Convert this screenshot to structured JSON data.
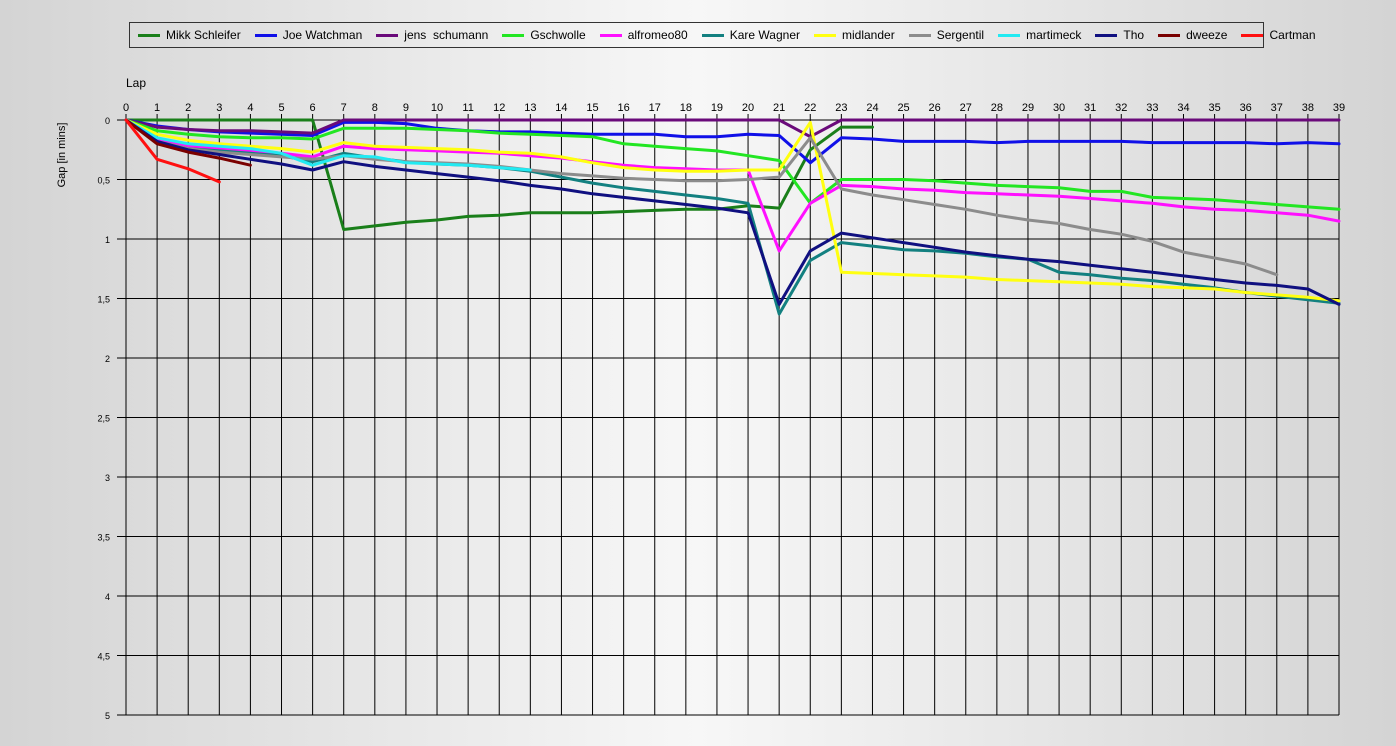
{
  "chart_data": {
    "type": "line",
    "title": "",
    "xlabel": "Lap",
    "ylabel": "Gap [in mins]",
    "xlim": [
      0,
      39
    ],
    "ylim": [
      0,
      5
    ],
    "y_inverted": true,
    "grid": true,
    "legend_position": "top",
    "x_ticks": [
      "0",
      "1",
      "2",
      "3",
      "4",
      "5",
      "6",
      "7",
      "8",
      "9",
      "10",
      "11",
      "12",
      "13",
      "14",
      "15",
      "16",
      "17",
      "18",
      "19",
      "20",
      "21",
      "22",
      "23",
      "24",
      "25",
      "26",
      "27",
      "28",
      "29",
      "30",
      "31",
      "32",
      "33",
      "34",
      "35",
      "36",
      "37",
      "38",
      "39"
    ],
    "y_ticks": [
      {
        "value": 0,
        "label": "0"
      },
      {
        "value": 0.5,
        "label": "0,5"
      },
      {
        "value": 1,
        "label": "1"
      },
      {
        "value": 1.5,
        "label": "1,5"
      },
      {
        "value": 2,
        "label": "2"
      },
      {
        "value": 2.5,
        "label": "2,5"
      },
      {
        "value": 3,
        "label": "3"
      },
      {
        "value": 3.5,
        "label": "3,5"
      },
      {
        "value": 4,
        "label": "4"
      },
      {
        "value": 4.5,
        "label": "4,5"
      },
      {
        "value": 5,
        "label": "5"
      }
    ],
    "series": [
      {
        "name": "Mikk Schleifer",
        "color": "#1a7f1a",
        "x": [
          0,
          1,
          2,
          3,
          4,
          5,
          6,
          7,
          8,
          9,
          10,
          11,
          12,
          13,
          14,
          15,
          16,
          17,
          18,
          19,
          20,
          21,
          22,
          23,
          24
        ],
        "y": [
          0,
          0,
          0,
          0,
          0,
          0,
          0,
          0.92,
          0.89,
          0.86,
          0.84,
          0.81,
          0.8,
          0.78,
          0.78,
          0.78,
          0.77,
          0.76,
          0.75,
          0.75,
          0.72,
          0.74,
          0.25,
          0.06,
          0.06
        ]
      },
      {
        "name": "Joe Watchman",
        "color": "#1010e8",
        "x": [
          0,
          1,
          2,
          3,
          4,
          5,
          6,
          7,
          8,
          9,
          10,
          11,
          12,
          13,
          14,
          15,
          16,
          17,
          18,
          19,
          20,
          21,
          22,
          23,
          24,
          25,
          26,
          27,
          28,
          29,
          30,
          31,
          32,
          33,
          34,
          35,
          36,
          37,
          38,
          39
        ],
        "y": [
          0,
          0.05,
          0.08,
          0.1,
          0.11,
          0.12,
          0.13,
          0.02,
          0.02,
          0.03,
          0.07,
          0.09,
          0.1,
          0.1,
          0.11,
          0.12,
          0.12,
          0.12,
          0.14,
          0.14,
          0.12,
          0.13,
          0.36,
          0.15,
          0.16,
          0.18,
          0.18,
          0.18,
          0.19,
          0.18,
          0.18,
          0.18,
          0.18,
          0.19,
          0.19,
          0.19,
          0.19,
          0.2,
          0.19,
          0.2
        ]
      },
      {
        "name": "jens  schumann",
        "color": "#6a0a7a",
        "x": [
          0,
          1,
          2,
          3,
          4,
          5,
          6,
          7,
          8,
          9,
          10,
          11,
          12,
          13,
          14,
          15,
          16,
          17,
          18,
          19,
          20,
          21,
          22,
          23,
          24,
          25,
          26,
          27,
          28,
          29,
          30,
          31,
          32,
          33,
          34,
          35,
          36,
          37,
          38,
          39
        ],
        "y": [
          0,
          0.06,
          0.08,
          0.09,
          0.09,
          0.1,
          0.11,
          0,
          0,
          0,
          0,
          0,
          0,
          0,
          0,
          0,
          0,
          0,
          0,
          0,
          0,
          0,
          0.14,
          0,
          0,
          0,
          0,
          0,
          0,
          0,
          0,
          0,
          0,
          0,
          0,
          0,
          0,
          0,
          0,
          0
        ]
      },
      {
        "name": "Gschwolle",
        "color": "#22e622",
        "x": [
          0,
          1,
          2,
          3,
          4,
          5,
          6,
          7,
          8,
          9,
          10,
          11,
          12,
          13,
          14,
          15,
          16,
          17,
          18,
          19,
          20,
          21,
          22,
          23,
          24,
          25,
          26,
          27,
          28,
          29,
          30,
          31,
          32,
          33,
          34,
          35,
          36,
          37,
          38,
          39
        ],
        "y": [
          0,
          0.09,
          0.12,
          0.14,
          0.15,
          0.15,
          0.16,
          0.07,
          0.07,
          0.07,
          0.08,
          0.09,
          0.11,
          0.12,
          0.13,
          0.14,
          0.2,
          0.22,
          0.24,
          0.26,
          0.3,
          0.34,
          0.7,
          0.5,
          0.5,
          0.5,
          0.51,
          0.53,
          0.55,
          0.56,
          0.57,
          0.6,
          0.6,
          0.65,
          0.66,
          0.67,
          0.69,
          0.71,
          0.73,
          0.75
        ]
      },
      {
        "name": "alfromeo80",
        "color": "#ff10ff",
        "x": [
          0,
          1,
          2,
          3,
          4,
          5,
          6,
          7,
          8,
          9,
          10,
          11,
          12,
          13,
          14,
          15,
          16,
          17,
          18,
          19,
          20,
          21,
          22,
          23,
          24,
          25,
          26,
          27,
          28,
          29,
          30,
          31,
          32,
          33,
          34,
          35,
          36,
          37,
          38,
          39
        ],
        "y": [
          0,
          0.17,
          0.22,
          0.24,
          0.26,
          0.28,
          0.31,
          0.22,
          0.24,
          0.25,
          0.26,
          0.27,
          0.28,
          0.3,
          0.32,
          0.35,
          0.38,
          0.4,
          0.41,
          0.42,
          0.42,
          1.1,
          0.7,
          0.55,
          0.56,
          0.58,
          0.59,
          0.61,
          0.62,
          0.63,
          0.64,
          0.66,
          0.68,
          0.7,
          0.73,
          0.75,
          0.76,
          0.78,
          0.8,
          0.85
        ]
      },
      {
        "name": "Kare Wagner",
        "color": "#138080",
        "x": [
          0,
          1,
          2,
          3,
          4,
          5,
          6,
          7,
          8,
          9,
          10,
          11,
          12,
          13,
          14,
          15,
          16,
          17,
          18,
          19,
          20,
          21,
          22,
          23,
          24,
          25,
          26,
          27,
          28,
          29,
          30,
          31,
          32,
          33,
          34,
          35,
          36,
          37,
          38,
          39
        ],
        "y": [
          0,
          0.19,
          0.24,
          0.26,
          0.28,
          0.3,
          0.35,
          0.28,
          0.32,
          0.35,
          0.37,
          0.38,
          0.4,
          0.43,
          0.48,
          0.53,
          0.57,
          0.6,
          0.63,
          0.66,
          0.7,
          1.63,
          1.18,
          1.03,
          1.06,
          1.09,
          1.1,
          1.12,
          1.15,
          1.17,
          1.28,
          1.3,
          1.33,
          1.35,
          1.38,
          1.41,
          1.45,
          1.48,
          1.51,
          1.54
        ]
      },
      {
        "name": "midlander",
        "color": "#ffff10",
        "x": [
          0,
          1,
          2,
          3,
          4,
          5,
          6,
          7,
          8,
          9,
          10,
          11,
          12,
          13,
          14,
          15,
          16,
          17,
          18,
          19,
          20,
          21,
          22,
          23,
          24,
          25,
          26,
          27,
          28,
          29,
          30,
          31,
          32,
          33,
          34,
          35,
          36,
          37,
          38,
          39
        ],
        "y": [
          0,
          0.12,
          0.17,
          0.2,
          0.22,
          0.24,
          0.27,
          0.19,
          0.22,
          0.23,
          0.24,
          0.25,
          0.27,
          0.28,
          0.31,
          0.36,
          0.4,
          0.42,
          0.43,
          0.43,
          0.42,
          0.42,
          0.02,
          1.28,
          1.29,
          1.3,
          1.31,
          1.32,
          1.34,
          1.35,
          1.36,
          1.37,
          1.38,
          1.4,
          1.41,
          1.42,
          1.45,
          1.47,
          1.49,
          1.52
        ]
      },
      {
        "name": "Sergentil",
        "color": "#8c8c8c",
        "x": [
          0,
          1,
          2,
          3,
          4,
          5,
          6,
          7,
          8,
          9,
          10,
          11,
          12,
          13,
          14,
          15,
          16,
          17,
          18,
          19,
          20,
          21,
          22,
          23,
          24,
          25,
          26,
          27,
          28,
          29,
          30,
          31,
          32,
          33,
          34,
          35,
          36,
          37
        ],
        "y": [
          0,
          0.18,
          0.24,
          0.27,
          0.29,
          0.31,
          0.33,
          0.3,
          0.33,
          0.35,
          0.36,
          0.37,
          0.39,
          0.42,
          0.45,
          0.47,
          0.49,
          0.5,
          0.51,
          0.51,
          0.5,
          0.48,
          0.15,
          0.58,
          0.63,
          0.67,
          0.71,
          0.75,
          0.8,
          0.84,
          0.87,
          0.92,
          0.96,
          1.02,
          1.11,
          1.16,
          1.21,
          1.3
        ]
      },
      {
        "name": "martimeck",
        "color": "#22eaf2",
        "x": [
          0,
          1,
          2,
          3,
          4,
          5,
          6,
          7,
          8,
          9,
          10,
          11,
          12,
          13
        ],
        "y": [
          0,
          0.15,
          0.2,
          0.22,
          0.24,
          0.28,
          0.38,
          0.3,
          0.31,
          0.36,
          0.37,
          0.38,
          0.4,
          0.42
        ]
      },
      {
        "name": "Tho",
        "color": "#101080",
        "x": [
          0,
          1,
          2,
          3,
          4,
          5,
          6,
          7,
          8,
          9,
          10,
          11,
          12,
          13,
          14,
          15,
          16,
          17,
          18,
          19,
          20,
          21,
          22,
          23,
          24,
          25,
          26,
          27,
          28,
          29,
          30,
          31,
          32,
          33,
          34,
          35,
          36,
          37,
          38,
          39
        ],
        "y": [
          0,
          0.18,
          0.25,
          0.29,
          0.33,
          0.37,
          0.42,
          0.35,
          0.39,
          0.42,
          0.45,
          0.48,
          0.51,
          0.55,
          0.58,
          0.62,
          0.65,
          0.68,
          0.71,
          0.74,
          0.78,
          1.55,
          1.1,
          0.95,
          0.99,
          1.03,
          1.07,
          1.11,
          1.14,
          1.17,
          1.19,
          1.22,
          1.25,
          1.28,
          1.31,
          1.34,
          1.37,
          1.39,
          1.42,
          1.55
        ]
      },
      {
        "name": "dweeze",
        "color": "#7a0000",
        "x": [
          0,
          1,
          2,
          3,
          4
        ],
        "y": [
          0,
          0.2,
          0.27,
          0.32,
          0.38
        ]
      },
      {
        "name": "Cartman",
        "color": "#ff1010",
        "x": [
          0,
          1,
          2,
          3
        ],
        "y": [
          0,
          0.33,
          0.41,
          0.52
        ]
      }
    ]
  }
}
